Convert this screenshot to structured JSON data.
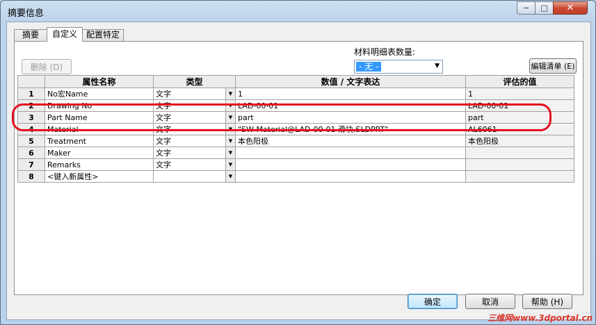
{
  "window": {
    "title": "摘要信息",
    "minimize": "−",
    "maximize": "□",
    "close": "✕"
  },
  "tabs": [
    {
      "label": "摘要",
      "active": false
    },
    {
      "label": "自定义",
      "active": true
    },
    {
      "label": "配置特定",
      "active": false
    }
  ],
  "toolbar": {
    "delete_label": "删除 (D)",
    "bom_qty_label": "材料明细表数量:",
    "bom_qty_value": "- 无 -",
    "edit_list_label": "編辑清单 (E)"
  },
  "table": {
    "columns": [
      "属性名称",
      "类型",
      "数值 / 文字表达",
      "评估的值"
    ],
    "rows": [
      {
        "num": "1",
        "name": "No宏Name",
        "type": "文字",
        "value": "1",
        "evaluated": "1"
      },
      {
        "num": "2",
        "name": "Drawing No",
        "type": "文字",
        "value": "LAD-00-01",
        "evaluated": "LAD-00-01"
      },
      {
        "num": "3",
        "name": "Part Name",
        "type": "文字",
        "value": "part",
        "evaluated": "part"
      },
      {
        "num": "4",
        "name": "Material",
        "type": "文字",
        "value": "\"SW-Material@LAD-00-01 滑块.SLDPRT\"",
        "evaluated": "AL6061"
      },
      {
        "num": "5",
        "name": "Treatment",
        "type": "文字",
        "value": "本色阳极",
        "evaluated": "本色阳极"
      },
      {
        "num": "6",
        "name": "Maker",
        "type": "文字",
        "value": "",
        "evaluated": ""
      },
      {
        "num": "7",
        "name": "Remarks",
        "type": "文字",
        "value": "",
        "evaluated": ""
      },
      {
        "num": "8",
        "name": "<键入新属性>",
        "type": "",
        "value": "",
        "evaluated": ""
      }
    ]
  },
  "footer": {
    "ok_label": "确定",
    "cancel_label": "取消",
    "help_label": "帮助 (H)"
  },
  "watermark": "三维网www.3dportal.cn",
  "colors": {
    "highlight": "#e3111d",
    "selection": "#3399ff"
  }
}
